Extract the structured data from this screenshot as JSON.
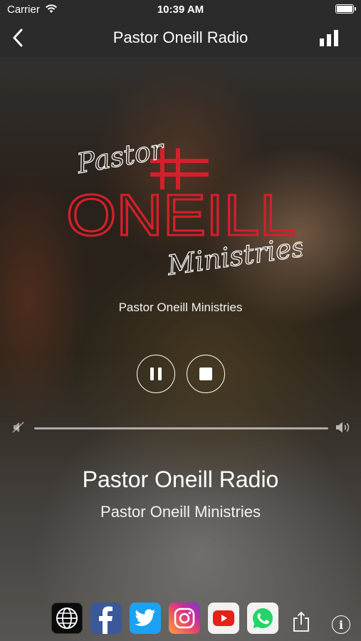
{
  "status_bar": {
    "carrier": "Carrier",
    "time": "10:39 AM"
  },
  "nav": {
    "title": "Pastor Oneill Radio",
    "back_icon": "chevron-left-icon",
    "stats_icon": "bar-chart-icon"
  },
  "logo": {
    "top": "Pastor",
    "main": "ONEILL",
    "bottom": "Ministries"
  },
  "station_subtitle": "Pastor Oneill Ministries",
  "player": {
    "state": "playing",
    "volume_level": 1.0
  },
  "track": {
    "title": "Pastor Oneill Radio",
    "artist": "Pastor Oneill Ministries"
  },
  "social": [
    {
      "name": "web",
      "icon": "globe-icon"
    },
    {
      "name": "facebook",
      "icon": "facebook-icon"
    },
    {
      "name": "twitter",
      "icon": "twitter-icon"
    },
    {
      "name": "instagram",
      "icon": "instagram-icon"
    },
    {
      "name": "youtube",
      "icon": "youtube-icon"
    },
    {
      "name": "whatsapp",
      "icon": "whatsapp-icon"
    }
  ],
  "colors": {
    "bar": "#2b2b2b",
    "logo_red": "#d4202a",
    "facebook": "#3b5998",
    "twitter": "#1da1f2",
    "youtube": "#e62117",
    "whatsapp": "#25d366"
  }
}
